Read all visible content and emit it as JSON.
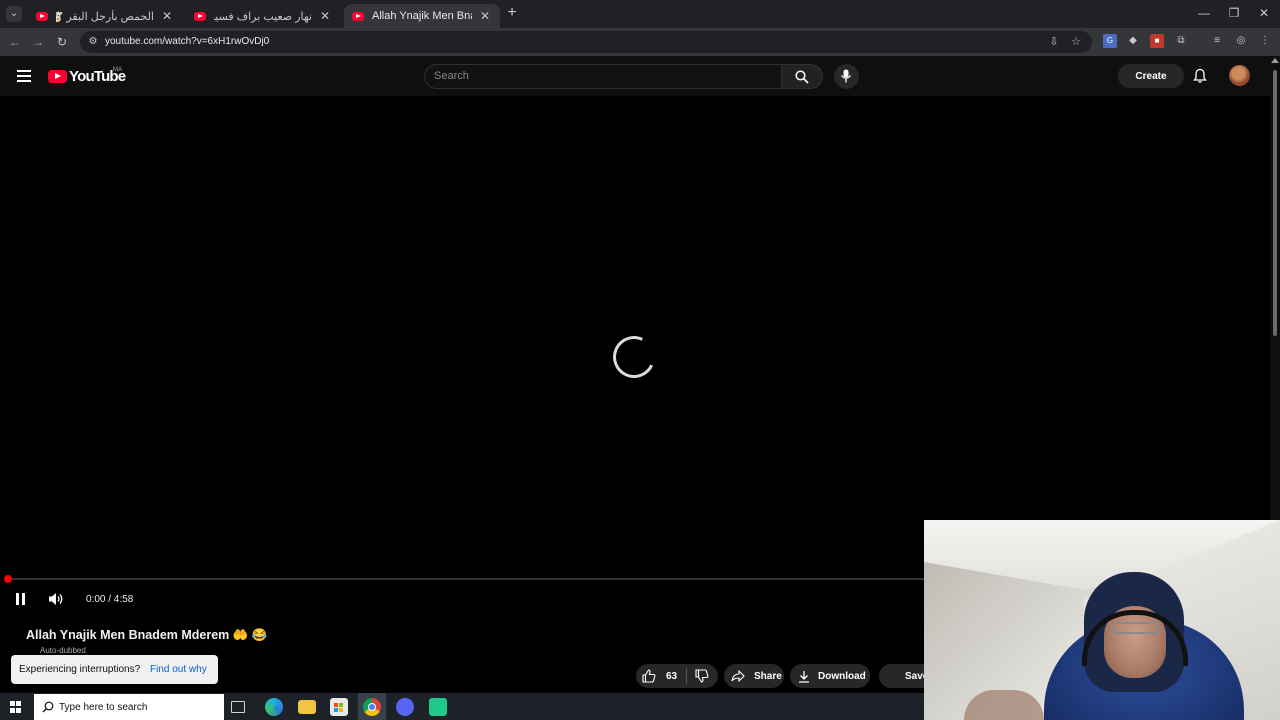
{
  "browser": {
    "tabs": [
      {
        "title": "الحمص بأرجل البقر 🐮 و تقليم أ..."
      },
      {
        "title": "نهار صعيب براف فسيبيريا ❄️ جلـ..."
      },
      {
        "title": "Allah Ynajik Men Bnadem Mderem"
      }
    ],
    "url": "youtube.com/watch?v=6xH1rwOvDj0"
  },
  "youtube": {
    "country_code": "MA",
    "logo_text": "YouTube",
    "search_placeholder": "Search",
    "create_label": "Create"
  },
  "player": {
    "current_time": "0:00",
    "duration": "4:58",
    "time_display": "0:00 / 4:58",
    "progress_fraction": 0.0
  },
  "video": {
    "title": "Allah Ynajik Men Bnadem Mderem 🤲 😂",
    "auto_dubbed_label": "Auto-dubbed",
    "like_count": "63",
    "share_label": "Share",
    "download_label": "Download",
    "save_label": "Save"
  },
  "toast": {
    "message": "Experiencing interruptions?",
    "link": "Find out why"
  },
  "taskbar": {
    "search_placeholder": "Type here to search"
  },
  "colors": {
    "brand_red": "#ff0033",
    "page_bg": "#0f0f0f",
    "link_blue": "#065fd4"
  }
}
